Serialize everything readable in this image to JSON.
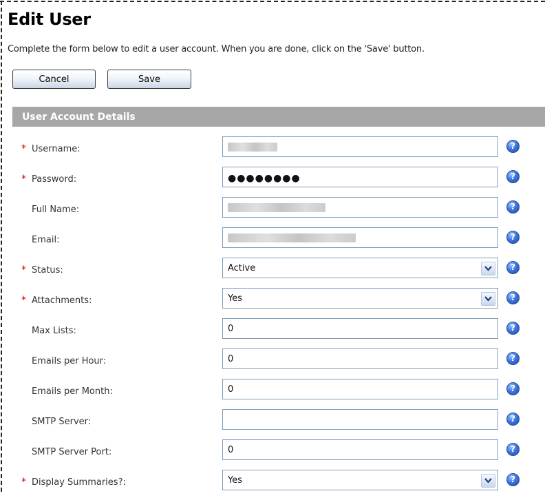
{
  "page": {
    "title": "Edit User",
    "intro": "Complete the form below to edit a user account. When you are done, click on the 'Save' button."
  },
  "buttons": {
    "cancel": "Cancel",
    "save": "Save"
  },
  "section": {
    "title": "User Account Details"
  },
  "fields": {
    "username": {
      "label": "Username:",
      "required": "*"
    },
    "password": {
      "label": "Password:",
      "required": "*",
      "value": "●●●●●●●●"
    },
    "full_name": {
      "label": "Full Name:"
    },
    "email": {
      "label": "Email:"
    },
    "status": {
      "label": "Status:",
      "required": "*",
      "value": "Active"
    },
    "attachments": {
      "label": "Attachments:",
      "required": "*",
      "value": "Yes"
    },
    "max_lists": {
      "label": "Max Lists:",
      "value": "0"
    },
    "emails_per_hour": {
      "label": "Emails per Hour:",
      "value": "0"
    },
    "emails_per_month": {
      "label": "Emails per Month:",
      "value": "0"
    },
    "smtp_server": {
      "label": "SMTP Server:",
      "value": ""
    },
    "smtp_server_port": {
      "label": "SMTP Server Port:",
      "value": "0"
    },
    "display_summaries": {
      "label": "Display Summaries?:",
      "required": "*",
      "value": "Yes"
    }
  },
  "icons": {
    "help": "help-icon",
    "dropdown": "chevron-down-icon"
  },
  "help_glyph": "?",
  "colors": {
    "section_bar": "#a7a7a7",
    "required": "#cc0000",
    "help_icon": "#3f78e0"
  }
}
